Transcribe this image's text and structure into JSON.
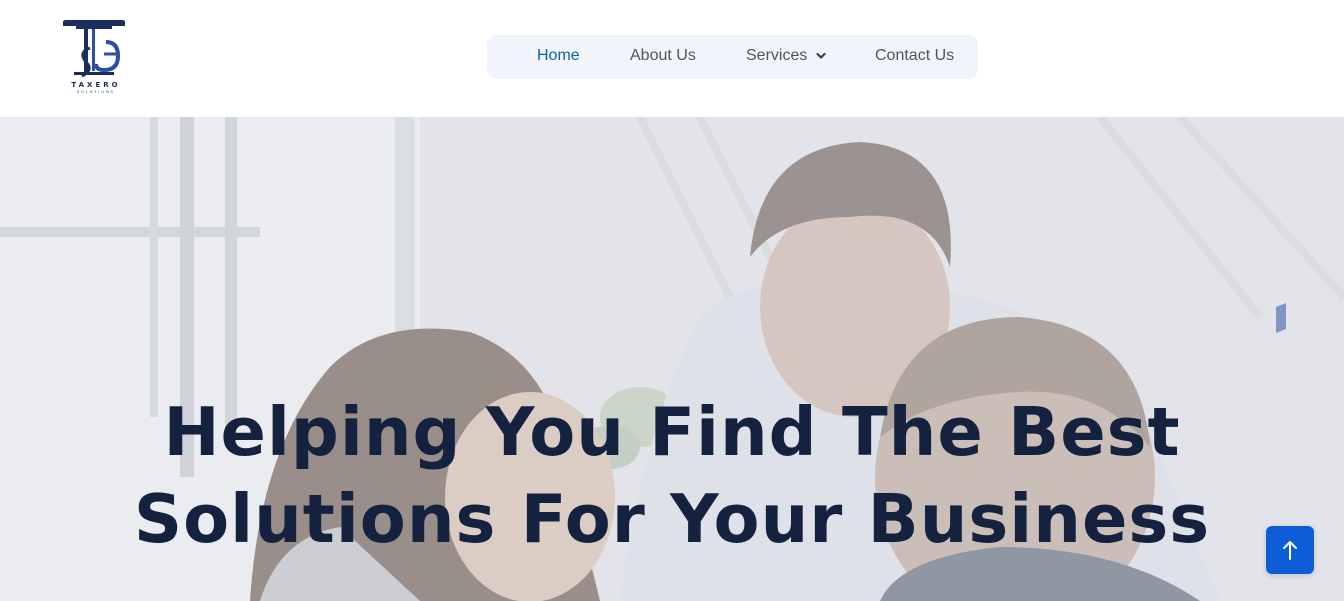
{
  "brand": {
    "name": "TAXERO",
    "tagline": "SOLUTIONS",
    "primary_color": "#1b2c5e",
    "accent_color": "#0f5eb0"
  },
  "nav": {
    "items": [
      {
        "label": "Home",
        "active": true
      },
      {
        "label": "About Us",
        "active": false
      },
      {
        "label": "Services",
        "active": false,
        "has_dropdown": true,
        "icon": "chevron-down-icon"
      },
      {
        "label": "Contact Us",
        "active": false
      }
    ]
  },
  "hero": {
    "headline_line1": "Helping You Find The Best",
    "headline_line2": "Solutions For Your Business",
    "image": "office-team-photo"
  },
  "scroll_top": {
    "icon": "arrow-up-icon",
    "color": "#0d5dd8"
  }
}
